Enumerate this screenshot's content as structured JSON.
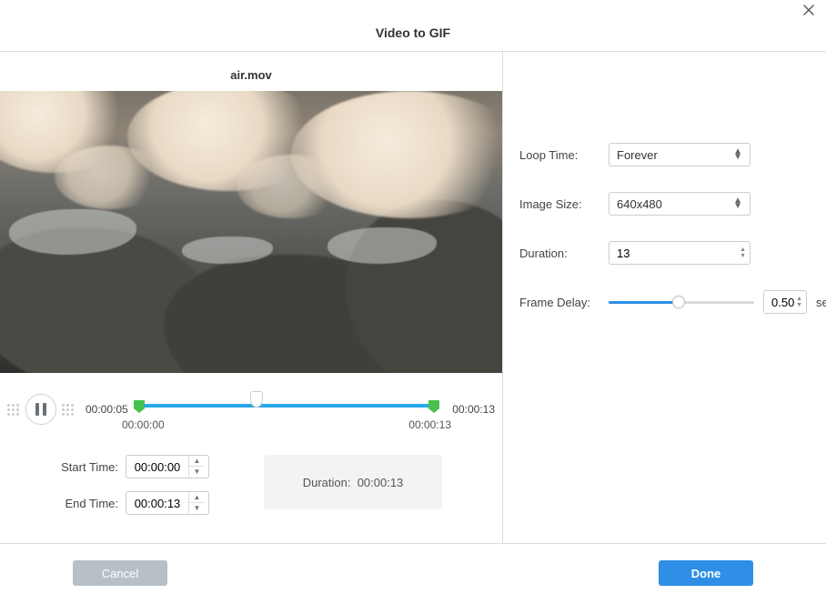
{
  "header": {
    "title": "Video to GIF"
  },
  "file": {
    "name": "air.mov"
  },
  "playback": {
    "current_time": "00:00:05",
    "clip_end_time": "00:00:13",
    "trim_start_under": "00:00:00",
    "trim_end_under": "00:00:13"
  },
  "times": {
    "start_label": "Start Time:",
    "start_value": "00:00:00",
    "end_label": "End Time:",
    "end_value": "00:00:13"
  },
  "duration_box": {
    "label": "Duration:",
    "value": "00:00:13"
  },
  "options": {
    "loop_time": {
      "label": "Loop Time:",
      "value": "Forever"
    },
    "image_size": {
      "label": "Image Size:",
      "value": "640x480"
    },
    "duration": {
      "label": "Duration:",
      "value": "13"
    },
    "frame_delay": {
      "label": "Frame Delay:",
      "value": "0.50",
      "unit": "sec"
    }
  },
  "footer": {
    "cancel_label": "Cancel",
    "done_label": "Done"
  }
}
